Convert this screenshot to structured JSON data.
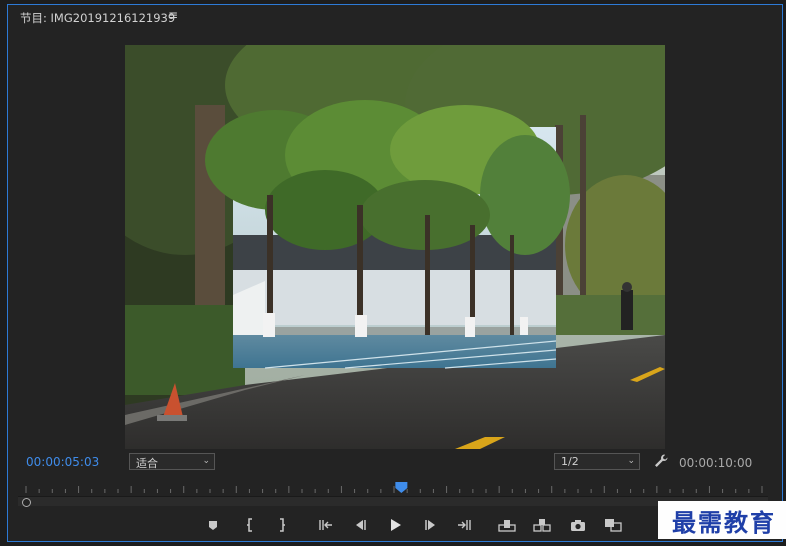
{
  "panel": {
    "title": "节目: IMG20191216121939",
    "menu_icon": "≡"
  },
  "controls": {
    "current_timecode": "00:00:05:03",
    "fit_dropdown_value": "适合",
    "resolution_dropdown_value": "1/2",
    "duration_timecode": "00:00:10:00",
    "chevron": "⌄",
    "add_button_label": "+"
  },
  "playback": {
    "playhead_progress": 0.51
  },
  "icons": [
    "hamburger-menu-icon",
    "chevron-down-icon",
    "wrench-icon",
    "add-marker-icon",
    "mark-in-icon",
    "mark-out-icon",
    "go-to-in-icon",
    "step-back-icon",
    "play-icon",
    "step-forward-icon",
    "go-to-out-icon",
    "lift-icon",
    "extract-icon",
    "export-frame-icon",
    "comparison-view-icon",
    "plus-icon"
  ],
  "colors": {
    "accent": "#3f8cea",
    "panel_border": "#2d7ad6",
    "background": "#232323"
  },
  "watermark": {
    "text": "最需教育"
  }
}
